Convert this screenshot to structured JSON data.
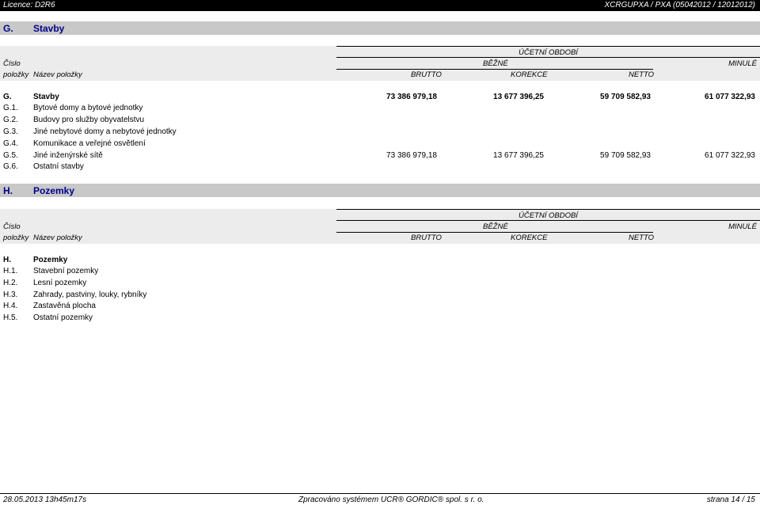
{
  "header": {
    "licence": "Licence: D2R6",
    "report_code": "XCRGUPXA / PXA (05042012 / 12012012)"
  },
  "column_headers": {
    "cislo": "Číslo",
    "polozky": "položky",
    "nazev": "Název položky",
    "ucetni_obdobi": "ÚČETNÍ OBDOBÍ",
    "bezne": "BĚŽNÉ",
    "minule": "MINULÉ",
    "brutto": "BRUTTO",
    "korekce": "KOREKCE",
    "netto": "NETTO"
  },
  "sections": [
    {
      "code": "G.",
      "title": "Stavby",
      "rows": [
        {
          "code": "G.",
          "name": "Stavby",
          "brutto": "73 386 979,18",
          "korekce": "13 677 396,25",
          "netto": "59 709 582,93",
          "minule": "61 077 322,93"
        },
        {
          "code": "G.1.",
          "name": "Bytové domy a bytové jednotky",
          "brutto": "",
          "korekce": "",
          "netto": "",
          "minule": ""
        },
        {
          "code": "G.2.",
          "name": "Budovy pro služby obyvatelstvu",
          "brutto": "",
          "korekce": "",
          "netto": "",
          "minule": ""
        },
        {
          "code": "G.3.",
          "name": "Jiné nebytové domy a nebytové jednotky",
          "brutto": "",
          "korekce": "",
          "netto": "",
          "minule": ""
        },
        {
          "code": "G.4.",
          "name": "Komunikace a veřejné osvětlení",
          "brutto": "",
          "korekce": "",
          "netto": "",
          "minule": ""
        },
        {
          "code": "G.5.",
          "name": "Jiné inženýrské sítě",
          "brutto": "73 386 979,18",
          "korekce": "13 677 396,25",
          "netto": "59 709 582,93",
          "minule": "61 077 322,93"
        },
        {
          "code": "G.6.",
          "name": "Ostatní stavby",
          "brutto": "",
          "korekce": "",
          "netto": "",
          "minule": ""
        }
      ]
    },
    {
      "code": "H.",
      "title": "Pozemky",
      "rows": [
        {
          "code": "H.",
          "name": "Pozemky",
          "brutto": "",
          "korekce": "",
          "netto": "",
          "minule": ""
        },
        {
          "code": "H.1.",
          "name": "Stavební pozemky",
          "brutto": "",
          "korekce": "",
          "netto": "",
          "minule": ""
        },
        {
          "code": "H.2.",
          "name": "Lesní pozemky",
          "brutto": "",
          "korekce": "",
          "netto": "",
          "minule": ""
        },
        {
          "code": "H.3.",
          "name": "Zahrady, pastviny, louky, rybníky",
          "brutto": "",
          "korekce": "",
          "netto": "",
          "minule": ""
        },
        {
          "code": "H.4.",
          "name": "Zastavěná plocha",
          "brutto": "",
          "korekce": "",
          "netto": "",
          "minule": ""
        },
        {
          "code": "H.5.",
          "name": "Ostatní pozemky",
          "brutto": "",
          "korekce": "",
          "netto": "",
          "minule": ""
        }
      ]
    }
  ],
  "footer": {
    "timestamp": "28.05.2013 13h45m17s",
    "processed_by": "Zpracováno systémem UCR® GORDIC® spol. s r. o.",
    "page": "strana 14 / 15"
  }
}
